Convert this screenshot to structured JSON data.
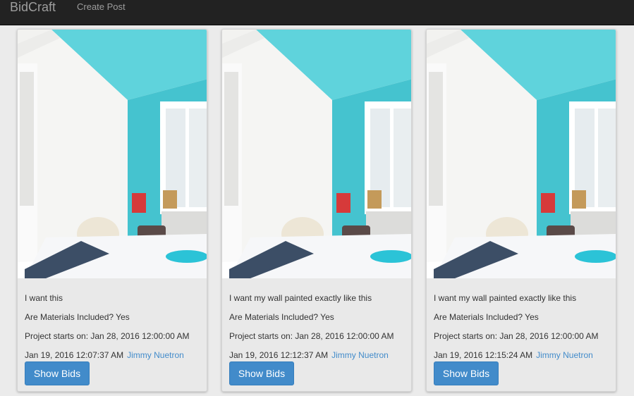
{
  "app": {
    "brand": "BidCraft",
    "nav": {
      "create_post": "Create Post"
    }
  },
  "posts": [
    {
      "title": "I want this",
      "materials": "Are Materials Included? Yes",
      "starts": "Project starts on: Jan 28, 2016 12:00:00 AM",
      "posted": "Jan 19, 2016 12:07:37 AM",
      "author": "Jimmy Nuetron",
      "button": "Show Bids",
      "image": "bedroom-photo"
    },
    {
      "title": "I want my wall painted exactly like this",
      "materials": "Are Materials Included? Yes",
      "starts": "Project starts on: Jan 28, 2016 12:00:00 AM",
      "posted": "Jan 19, 2016 12:12:37 AM",
      "author": "Jimmy Nuetron",
      "button": "Show Bids",
      "image": "bedroom-photo"
    },
    {
      "title": "I want my wall painted exactly like this",
      "materials": "Are Materials Included? Yes",
      "starts": "Project starts on: Jan 28, 2016 12:00:00 AM",
      "posted": "Jan 19, 2016 12:15:24 AM",
      "author": "Jimmy Nuetron",
      "button": "Show Bids",
      "image": "bedroom-photo"
    }
  ],
  "colors": {
    "navbar": "#222222",
    "accent": "#428bca",
    "ceiling": "#5fd3dc"
  }
}
